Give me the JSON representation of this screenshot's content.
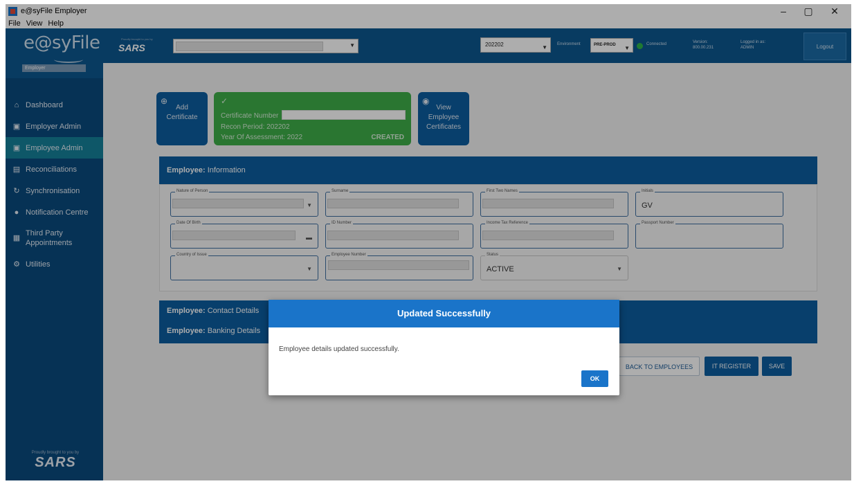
{
  "window": {
    "title": "e@syFile Employer",
    "controls": [
      "–",
      "▢",
      "✕"
    ]
  },
  "menu": [
    "File",
    "View",
    "Help"
  ],
  "sidebar": {
    "logo": "e@syFile",
    "badge": "Employer",
    "items": [
      {
        "label": "Dashboard",
        "icon": "home-icon",
        "glyph": "⌂"
      },
      {
        "label": "Employer Admin",
        "icon": "id-card-icon",
        "glyph": "▣"
      },
      {
        "label": "Employee Admin",
        "icon": "id-card-icon",
        "glyph": "▣"
      },
      {
        "label": "Reconciliations",
        "icon": "document-icon",
        "glyph": "▤"
      },
      {
        "label": "Synchronisation",
        "icon": "sync-icon",
        "glyph": "↻"
      },
      {
        "label": "Notification Centre",
        "icon": "bell-icon",
        "glyph": "●"
      },
      {
        "label": "Third Party Appointments",
        "icon": "calendar-icon",
        "glyph": "▦"
      },
      {
        "label": "Utilities",
        "icon": "gears-icon",
        "glyph": "⚙"
      }
    ],
    "footer_small": "Proudly brought to you by",
    "footer_brand": "SARS"
  },
  "topbar": {
    "brand": "SARS",
    "brand_small": "Proudly brought to you by",
    "year": "202202",
    "environment_label": "Environment",
    "environment": "PRE-PROD",
    "status": "Connected",
    "version_label": "Version:",
    "version": "800.00.231",
    "user_label": "Logged in as:",
    "user": "ADMIN",
    "logout": "Logout"
  },
  "cards": {
    "add": "Add Certificate",
    "cert_number_label": "Certificate Number",
    "recon_period": "Recon Period: 202202",
    "year_assessment": "Year Of Assessment: 2022",
    "state": "CREATED",
    "view": "View Employee Certificates"
  },
  "employee_info": {
    "title_bold": "Employee:",
    "title": "Information",
    "fields": {
      "nature": "Nature of Person",
      "surname": "Surname",
      "first_names": "First Two Names",
      "initials": "Initials",
      "initials_value": "GV",
      "dob": "Date Of Birth",
      "id_number": "ID Number",
      "tax_ref": "Income Tax Reference",
      "passport": "Passport Number",
      "country": "Country of Issue",
      "emp_number": "Employee Number",
      "status": "Status",
      "status_value": "ACTIVE"
    }
  },
  "sections": {
    "contact_bold": "Employee:",
    "contact": "Contact Details",
    "banking_bold": "Employee:",
    "banking": "Banking Details"
  },
  "actions": {
    "back": "BACK TO EMPLOYEES",
    "register": "IT REGISTER",
    "save": "SAVE"
  },
  "dialog": {
    "title": "Updated Successfully",
    "message": "Employee details updated successfully.",
    "ok": "OK"
  }
}
